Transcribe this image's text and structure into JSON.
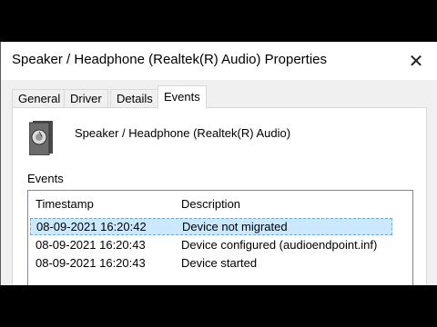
{
  "window": {
    "title": "Speaker / Headphone (Realtek(R) Audio) Properties",
    "close_glyph": "✕"
  },
  "tabs": [
    {
      "label": "General"
    },
    {
      "label": "Driver"
    },
    {
      "label": "Details"
    },
    {
      "label": "Events",
      "active": true
    }
  ],
  "device": {
    "name": "Speaker / Headphone (Realtek(R) Audio)",
    "icon": "speaker-icon"
  },
  "events": {
    "label": "Events",
    "columns": [
      "Timestamp",
      "Description"
    ],
    "rows": [
      {
        "timestamp": "08-09-2021 16:20:42",
        "description": "Device not migrated",
        "selected": true
      },
      {
        "timestamp": "08-09-2021 16:20:43",
        "description": "Device configured (audioendpoint.inf)"
      },
      {
        "timestamp": "08-09-2021 16:20:43",
        "description": "Device started"
      }
    ]
  },
  "colors": {
    "selection": "#cce8ff",
    "background": "#f0f0f0"
  }
}
